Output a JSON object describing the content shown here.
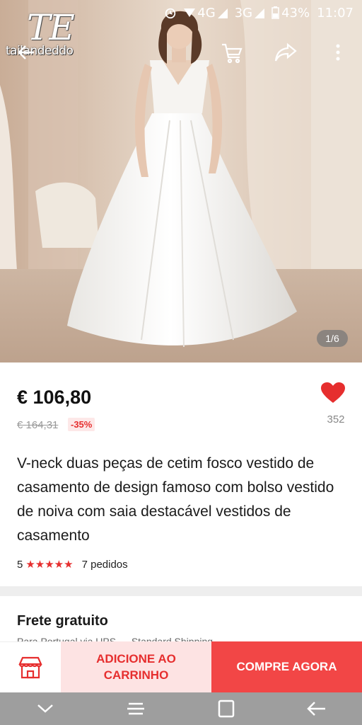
{
  "status_bar": {
    "network_1": "4G",
    "network_2": "3G",
    "battery": "43%",
    "time": "11:07"
  },
  "watermark": {
    "monogram": "TE",
    "text": "tailandeddo"
  },
  "top_bar": {
    "icons": [
      "back-arrow-icon",
      "cart-icon",
      "share-icon",
      "more-vertical-icon"
    ]
  },
  "gallery": {
    "counter": "1/6"
  },
  "product": {
    "price": "€ 106,80",
    "old_price": "€ 164,31",
    "discount": "-35%",
    "wishlist_count": "352",
    "title": "V-neck duas peças de cetim fosco vestido de casamento de design famoso com bolso vestido de noiva com saia destacável vestidos de casamento",
    "rating_value": "5",
    "stars": "★★★★★",
    "orders": "7 pedidos"
  },
  "shipping": {
    "title": "Frete gratuito",
    "subtitle": "Para Portugal via UPS — Standard Shipping"
  },
  "actions": {
    "add_to_cart": "ADICIONE AO CARRINHO",
    "buy_now": "COMPRE AGORA"
  },
  "colors": {
    "accent": "#e62e2e",
    "buy_button": "#f24646",
    "cart_button_bg": "#fde3e3",
    "nav_bar": "#9e9e9e"
  },
  "nav_bar": {
    "icons": [
      "nav-down-icon",
      "nav-recents-icon",
      "nav-home-icon",
      "nav-back-icon"
    ]
  }
}
